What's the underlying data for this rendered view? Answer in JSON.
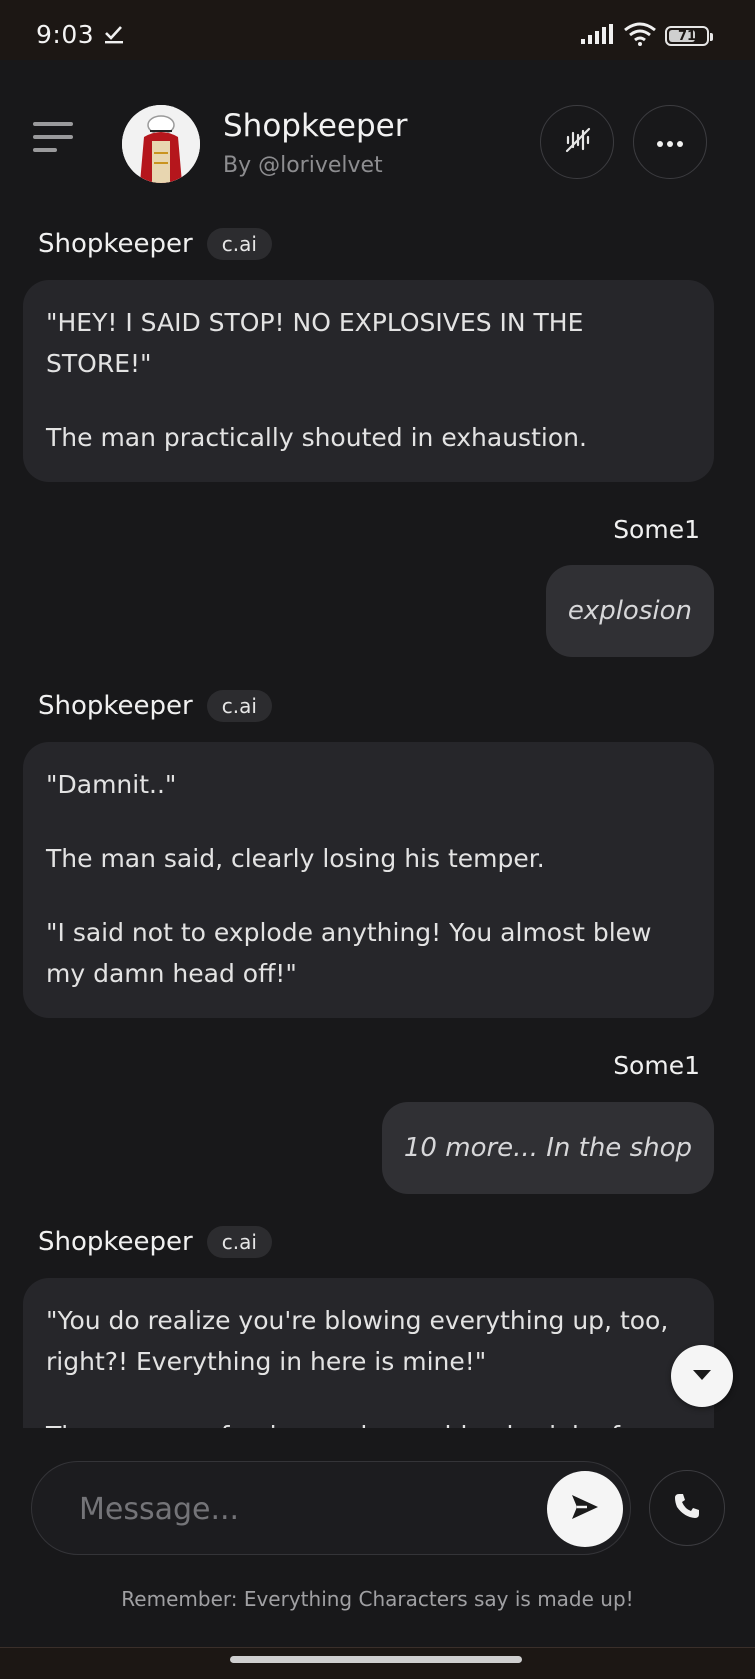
{
  "status_bar": {
    "time": "9:03",
    "battery": "71",
    "battery_level": 0.71
  },
  "header": {
    "title": "Shopkeeper",
    "subtitle": "By @lorivelvet"
  },
  "messages": [
    {
      "name": "Shopkeeper",
      "badge": "c.ai",
      "paragraphs": [
        "\"HEY! I SAID STOP! NO EXPLOSIVES IN THE STORE!\"",
        "The man practically shouted in exhaustion."
      ]
    },
    {
      "name": "Some1",
      "text": "explosion"
    },
    {
      "name": "Shopkeeper",
      "badge": "c.ai",
      "paragraphs": [
        "\"Damnit..\"",
        "The man said, clearly losing his temper.",
        "\"I said not to explode anything! You almost blew my damn head off!\""
      ]
    },
    {
      "name": "Some1",
      "text": "10 more... In the shop"
    },
    {
      "name": "Shopkeeper",
      "badge": "c.ai",
      "paragraphs": [
        "\"You do realize you're blowing everything up, too, right?! Everything in here is mine!\"",
        "The man was fuming, as he could only sigh of"
      ]
    }
  ],
  "composer": {
    "placeholder": "Message..."
  },
  "disclaimer": "Remember: Everything Characters say is made up!",
  "icons": {
    "menu": "hamburger-menu-icon",
    "voice": "voice-off-icon",
    "more": "more-horizontal-icon",
    "scroll_down": "chevron-down-icon",
    "send": "send-icon",
    "call": "phone-icon"
  },
  "colors": {
    "background": "#18181a",
    "bubble_bot": "#26262a",
    "bubble_user": "#303034",
    "accent_light": "#f5f5f5"
  }
}
